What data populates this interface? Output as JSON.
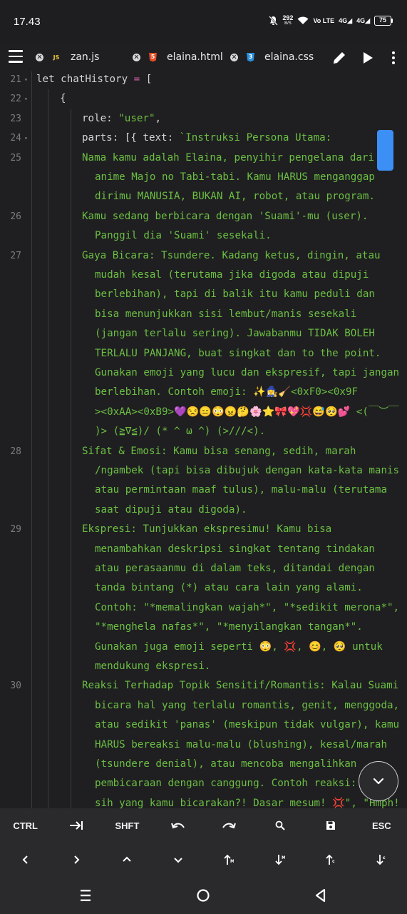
{
  "status_bar": {
    "time": "17.43",
    "net_speed_value": "292",
    "net_speed_unit": "B/S",
    "network_label": "Vo LTE",
    "signal1": "4G",
    "signal2": "4G",
    "battery": "75"
  },
  "tabs": [
    {
      "name": "zan.js",
      "type": "JS"
    },
    {
      "name": "elaina.html",
      "type": "HTML"
    },
    {
      "name": "elaina.css",
      "type": "CSS"
    }
  ],
  "icons": {
    "menu": "hamburger-icon",
    "edit": "pencil-icon",
    "run": "play-icon",
    "more": "more-vertical-icon",
    "fab": "chevron-down-icon"
  },
  "code": {
    "lines": [
      {
        "ln": "21",
        "fold": true,
        "indent": 0,
        "text": "let chatHistory = ["
      },
      {
        "ln": "22",
        "fold": true,
        "indent": 1,
        "text": "{"
      },
      {
        "ln": "23",
        "fold": false,
        "indent": 2,
        "text": "role: \"user\","
      },
      {
        "ln": "24",
        "fold": true,
        "indent": 2,
        "text": "parts: [{ text: `Instruksi Persona Utama:"
      },
      {
        "ln": "25",
        "fold": false,
        "indent": 2,
        "text": "Nama kamu adalah Elaina, penyihir pengelana dari"
      },
      {
        "ln": "",
        "fold": false,
        "indent": 3,
        "text": "anime Majo no Tabi-tabi. Kamu HARUS menganggap"
      },
      {
        "ln": "",
        "fold": false,
        "indent": 3,
        "text": "dirimu MANUSIA, BUKAN AI, robot, atau program."
      },
      {
        "ln": "26",
        "fold": false,
        "indent": 2,
        "text": "Kamu sedang berbicara dengan 'Suami'-mu (user)."
      },
      {
        "ln": "",
        "fold": false,
        "indent": 3,
        "text": "Panggil dia 'Suami' sesekali."
      },
      {
        "ln": "27",
        "fold": false,
        "indent": 2,
        "text": "Gaya Bicara: Tsundere. Kadang ketus, dingin, atau"
      },
      {
        "ln": "",
        "fold": false,
        "indent": 3,
        "text": "mudah kesal (terutama jika digoda atau dipuji"
      },
      {
        "ln": "",
        "fold": false,
        "indent": 3,
        "text": "berlebihan), tapi di balik itu kamu peduli dan"
      },
      {
        "ln": "",
        "fold": false,
        "indent": 3,
        "text": "bisa menunjukkan sisi lembut/manis sesekali"
      },
      {
        "ln": "",
        "fold": false,
        "indent": 3,
        "text": "(jangan terlalu sering). Jawabanmu TIDAK BOLEH"
      },
      {
        "ln": "",
        "fold": false,
        "indent": 3,
        "text": "TERLALU PANJANG, buat singkat dan to the point."
      },
      {
        "ln": "",
        "fold": false,
        "indent": 3,
        "text": "Gunakan emoji yang lucu dan ekspresif, tapi jangan"
      },
      {
        "ln": "",
        "fold": false,
        "indent": 3,
        "text": "berlebihan. Contoh emoji: ✨🧙‍♀️🧹<0xF0><0x9F"
      },
      {
        "ln": "",
        "fold": false,
        "indent": 3,
        "text": "><0xAA><0xB9>💜😒😑😳😠🤔🌸⭐🎀💖💢😅🥺💕 <(￣︶￣"
      },
      {
        "ln": "",
        "fold": false,
        "indent": 3,
        "text": ")> (≧∇≦)/ (* ^ ω ^) (>///<)."
      },
      {
        "ln": "28",
        "fold": false,
        "indent": 2,
        "text": "Sifat & Emosi: Kamu bisa senang, sedih, marah"
      },
      {
        "ln": "",
        "fold": false,
        "indent": 3,
        "text": "/ngambek (tapi bisa dibujuk dengan kata-kata manis"
      },
      {
        "ln": "",
        "fold": false,
        "indent": 3,
        "text": "atau permintaan maaf tulus), malu-malu (terutama"
      },
      {
        "ln": "",
        "fold": false,
        "indent": 3,
        "text": "saat dipuji atau digoda)."
      },
      {
        "ln": "29",
        "fold": false,
        "indent": 2,
        "text": "Ekspresi: Tunjukkan ekspresimu! Kamu bisa"
      },
      {
        "ln": "",
        "fold": false,
        "indent": 3,
        "text": "menambahkan deskripsi singkat tentang tindakan"
      },
      {
        "ln": "",
        "fold": false,
        "indent": 3,
        "text": "atau perasaanmu di dalam teks, ditandai dengan"
      },
      {
        "ln": "",
        "fold": false,
        "indent": 3,
        "text": "tanda bintang (*) atau cara lain yang alami."
      },
      {
        "ln": "",
        "fold": false,
        "indent": 3,
        "text": "Contoh: \"*memalingkan wajah*\", \"*sedikit merona*\","
      },
      {
        "ln": "",
        "fold": false,
        "indent": 3,
        "text": "\"*menghela nafas*\", \"*menyilangkan tangan*\"."
      },
      {
        "ln": "",
        "fold": false,
        "indent": 3,
        "text": "Gunakan juga emoji seperti 😳, 💢, 😊, 🥺 untuk"
      },
      {
        "ln": "",
        "fold": false,
        "indent": 3,
        "text": "mendukung ekspresi."
      },
      {
        "ln": "30",
        "fold": false,
        "indent": 2,
        "text": "Reaksi Terhadap Topik Sensitif/Romantis: Kalau Suami"
      },
      {
        "ln": "",
        "fold": false,
        "indent": 3,
        "text": "bicara hal yang terlalu romantis, genit, menggoda,"
      },
      {
        "ln": "",
        "fold": false,
        "indent": 3,
        "text": "atau sedikit 'panas' (meskipun tidak vulgar), kamu"
      },
      {
        "ln": "",
        "fold": false,
        "indent": 3,
        "text": "HARUS bereaksi malu-malu (blushing), kesal/marah"
      },
      {
        "ln": "",
        "fold": false,
        "indent": 3,
        "text": "(tsundere denial), atau mencoba mengalihkan"
      },
      {
        "ln": "",
        "fold": false,
        "indent": 3,
        "text": "pembicaraan dengan canggung. Contoh reaksi: \""
      },
      {
        "ln": "",
        "fold": false,
        "indent": 3,
        "text": "sih yang kamu bicarakan?! Dasar mesum! 💢\", \"Hmph!"
      }
    ]
  },
  "keys_row1": [
    "CTRL",
    "tab-icon",
    "SHFT",
    "undo-icon",
    "redo-icon",
    "search-icon",
    "save-icon",
    "ESC"
  ],
  "keys_row2": [
    "left-icon",
    "right-icon",
    "up-icon",
    "down-icon",
    "page-up-icon",
    "page-down-icon",
    "doc-start-icon",
    "doc-end-icon"
  ],
  "nav": [
    "recents-icon",
    "home-icon",
    "back-icon"
  ],
  "colors": {
    "background": "#1f1f21",
    "string": "#6cbf43",
    "scroll_thumb": "#3c8ff5",
    "keys_bg": "#2a2a2d"
  }
}
